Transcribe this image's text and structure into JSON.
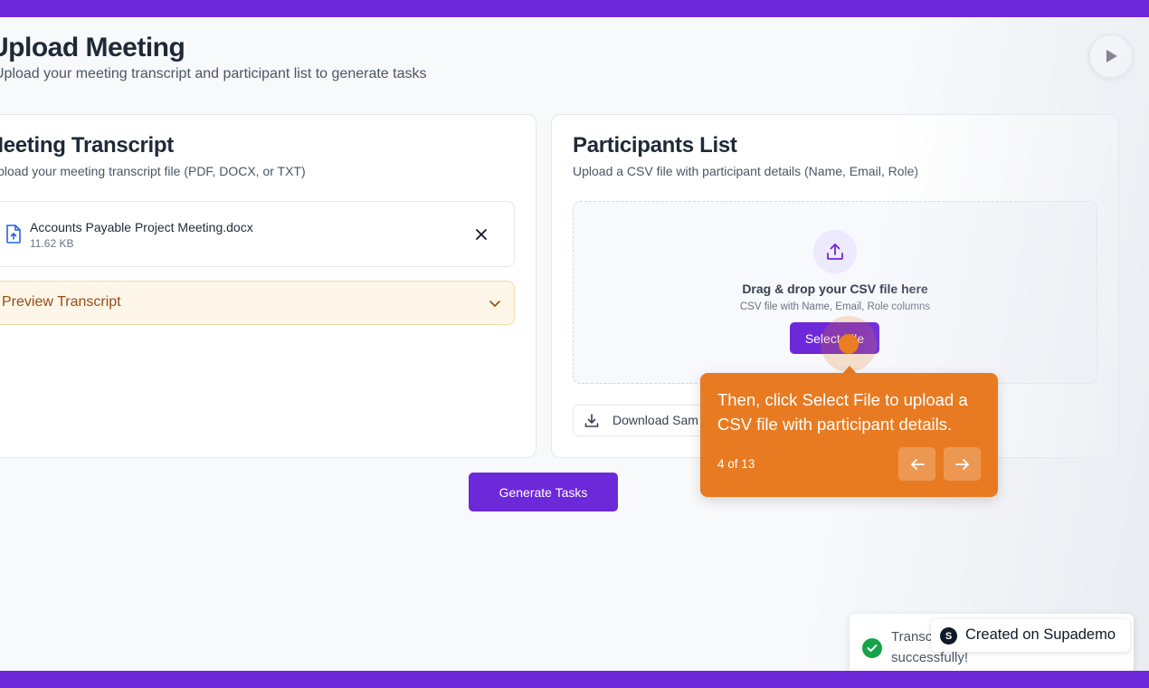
{
  "page": {
    "title": "Upload Meeting",
    "subtitle": "Upload your meeting transcript and participant list to generate tasks"
  },
  "transcript_card": {
    "title": "Meeting Transcript",
    "description": "Upload your meeting transcript file (PDF, DOCX, or TXT)",
    "file_name": "Accounts Payable Project Meeting.docx",
    "file_size": "11.62 KB",
    "preview_label": "Preview Transcript"
  },
  "participants_card": {
    "title": "Participants List",
    "description": "Upload a CSV file with participant details (Name, Email, Role)",
    "drop_title": "Drag & drop your CSV file here",
    "drop_hint": "CSV file with Name, Email, Role columns",
    "select_button": "Select File",
    "download_label": "Download Sam"
  },
  "actions": {
    "generate_button": "Generate Tasks"
  },
  "tooltip": {
    "text": "Then, click Select File to upload a CSV file with participant details.",
    "step": "4 of 13"
  },
  "toast": {
    "line1": "Transc",
    "line2": "successfully!"
  },
  "badge": {
    "logo_letter": "S",
    "text": "Created on Supademo"
  },
  "icons": {
    "play": "play-icon",
    "file": "file-upload-icon",
    "close": "close-icon",
    "chevron": "chevron-down-icon",
    "upload": "upload-icon",
    "download": "download-icon",
    "prev": "arrow-left-icon",
    "next": "arrow-right-icon",
    "check": "check-icon"
  },
  "colors": {
    "brand_purple": "#6d28d9",
    "tooltip_orange": "#e87b22",
    "preview_bg": "#fff6ea",
    "success_green": "#16a34a"
  }
}
